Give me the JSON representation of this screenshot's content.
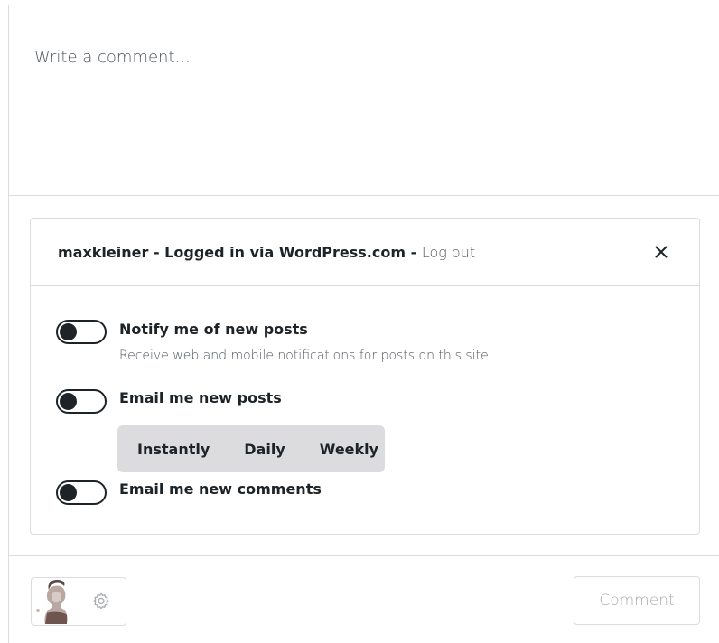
{
  "comment": {
    "placeholder": "Write a comment..."
  },
  "subscription_panel": {
    "username": "maxkleiner",
    "logged_in_text": " - Logged in via WordPress.com - ",
    "logout_label": "Log out",
    "close_icon": "close-icon",
    "options": [
      {
        "label": "Notify me of new posts",
        "description": "Receive web and mobile notifications for posts on this site.",
        "enabled": false
      },
      {
        "label": "Email me new posts",
        "enabled": false
      },
      {
        "label": "Email me new comments",
        "enabled": false
      }
    ],
    "frequency_options": [
      "Instantly",
      "Daily",
      "Weekly"
    ]
  },
  "footer": {
    "avatar_icon": "avatar",
    "settings_icon": "gear-icon",
    "comment_button_label": "Comment"
  },
  "colors": {
    "border": "#dcdcde",
    "text_dark": "#1d2327",
    "text_muted": "#50575e",
    "button_disabled_text": "#a7aaad",
    "segmented_bg": "#dcdcde"
  }
}
